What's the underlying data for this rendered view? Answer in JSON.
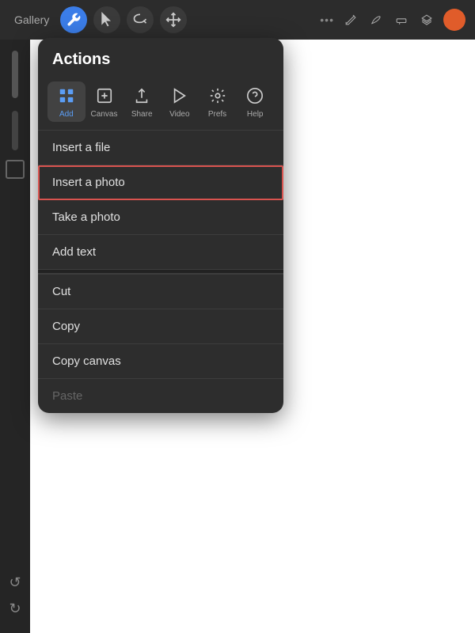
{
  "header": {
    "gallery_label": "Gallery",
    "more_dots": "•••"
  },
  "toolbar": {
    "icons": [
      "✏️",
      "🖊️",
      "◻️",
      "📋"
    ]
  },
  "panel": {
    "title": "Actions",
    "tabs": [
      {
        "id": "add",
        "label": "Add",
        "icon": "add",
        "active": true
      },
      {
        "id": "canvas",
        "label": "Canvas",
        "icon": "canvas",
        "active": false
      },
      {
        "id": "share",
        "label": "Share",
        "icon": "share",
        "active": false
      },
      {
        "id": "video",
        "label": "Video",
        "icon": "video",
        "active": false
      },
      {
        "id": "prefs",
        "label": "Prefs",
        "icon": "prefs",
        "active": false
      },
      {
        "id": "help",
        "label": "Help",
        "icon": "help",
        "active": false
      }
    ],
    "sections": [
      {
        "items": [
          {
            "id": "insert-file",
            "label": "Insert a file",
            "highlighted": false,
            "disabled": false
          },
          {
            "id": "insert-photo",
            "label": "Insert a photo",
            "highlighted": true,
            "disabled": false
          },
          {
            "id": "take-photo",
            "label": "Take a photo",
            "highlighted": false,
            "disabled": false
          },
          {
            "id": "add-text",
            "label": "Add text",
            "highlighted": false,
            "disabled": false
          }
        ]
      },
      {
        "items": [
          {
            "id": "cut",
            "label": "Cut",
            "highlighted": false,
            "disabled": false
          },
          {
            "id": "copy",
            "label": "Copy",
            "highlighted": false,
            "disabled": false
          },
          {
            "id": "copy-canvas",
            "label": "Copy canvas",
            "highlighted": false,
            "disabled": false
          },
          {
            "id": "paste",
            "label": "Paste",
            "highlighted": false,
            "disabled": true
          }
        ]
      }
    ]
  }
}
